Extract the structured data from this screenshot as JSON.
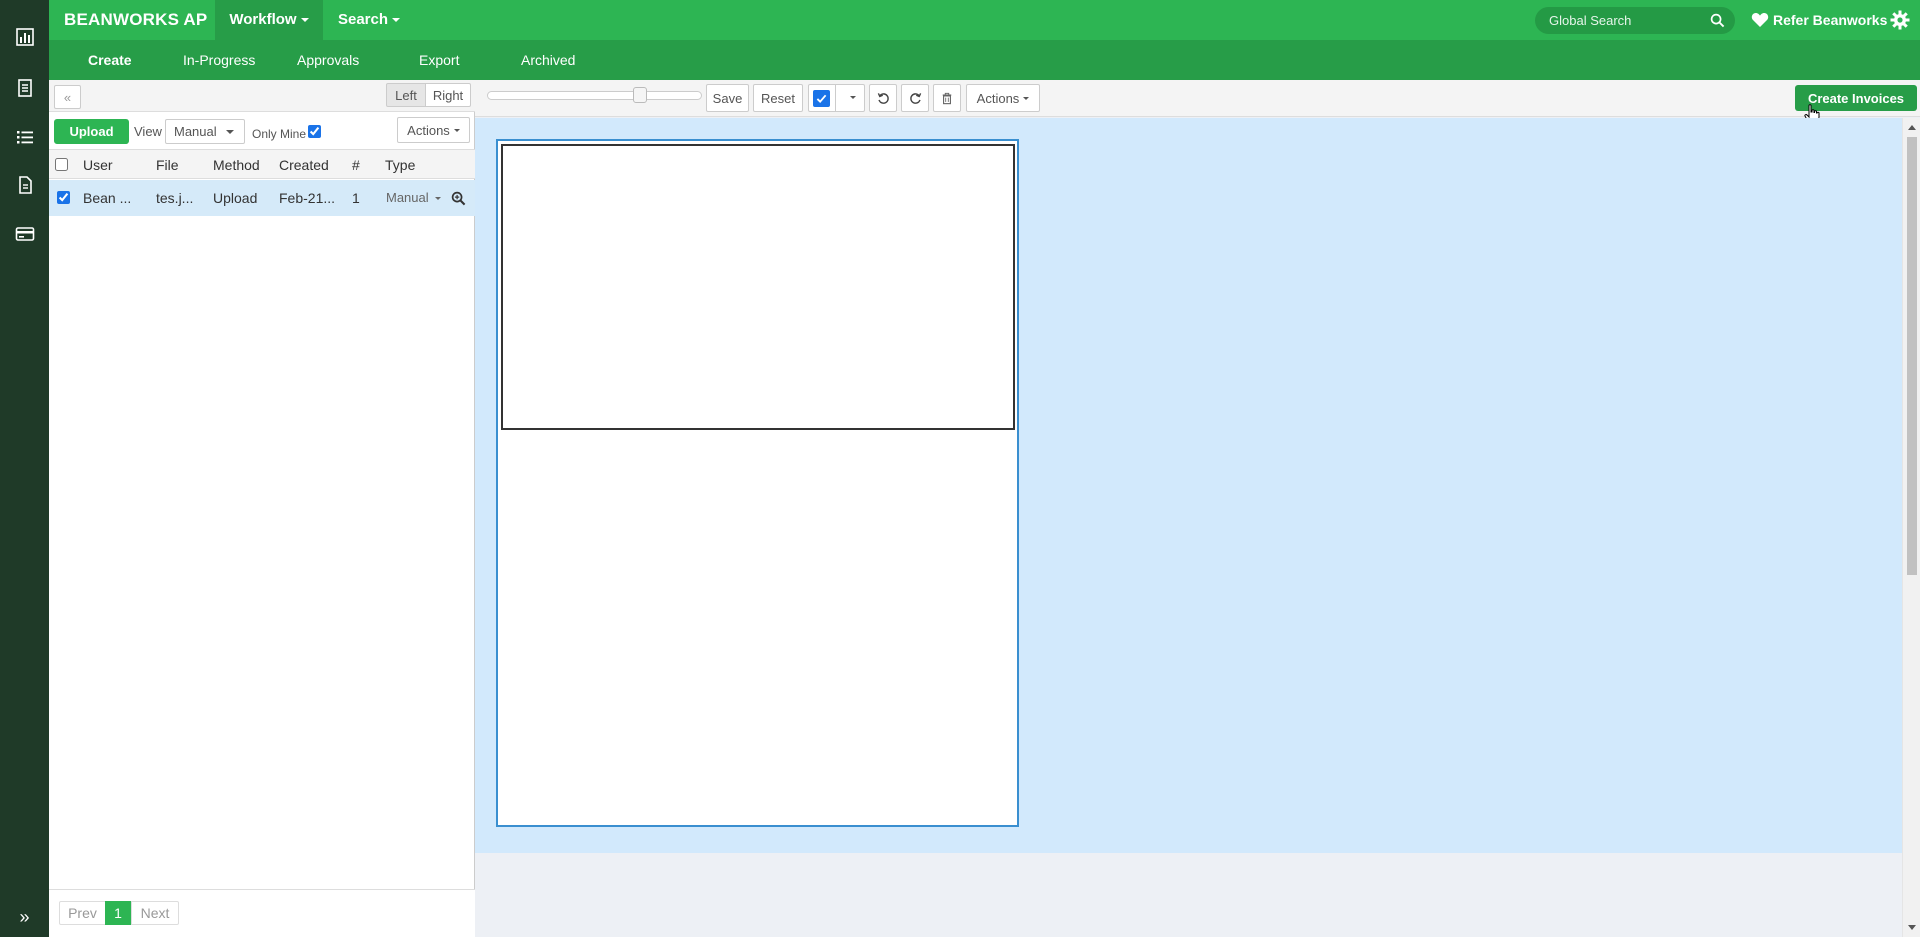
{
  "topbar": {
    "brand": "BEANWORKS AP",
    "workflow": "Workflow",
    "search": "Search",
    "global_search_placeholder": "Global Search",
    "refer": "Refer Beanworks"
  },
  "subnav": {
    "items": [
      "Create",
      "In-Progress",
      "Approvals",
      "Export",
      "Archived"
    ]
  },
  "left_panel": {
    "collapse": "«",
    "left": "Left",
    "right": "Right",
    "upload": "Upload",
    "view_label": "View",
    "view_value": "Manual",
    "only_mine": "Only Mine",
    "actions": "Actions",
    "columns": [
      "User",
      "File",
      "Method",
      "Created",
      "#",
      "Type"
    ],
    "rows": [
      {
        "user": "Bean ...",
        "file": "tes.j...",
        "method": "Upload",
        "created": "Feb-21...",
        "count": "1",
        "type": "Manual"
      }
    ],
    "pager": {
      "prev": "Prev",
      "page": "1",
      "next": "Next"
    }
  },
  "viewer": {
    "save": "Save",
    "reset": "Reset",
    "actions": "Actions",
    "create_invoices": "Create Invoices"
  },
  "colors": {
    "brand_green": "#2db553",
    "dark_green": "#279d48",
    "rail": "#1f3a28",
    "selected_row": "#d5eaf9",
    "doc_bg": "#d2e9fc"
  }
}
